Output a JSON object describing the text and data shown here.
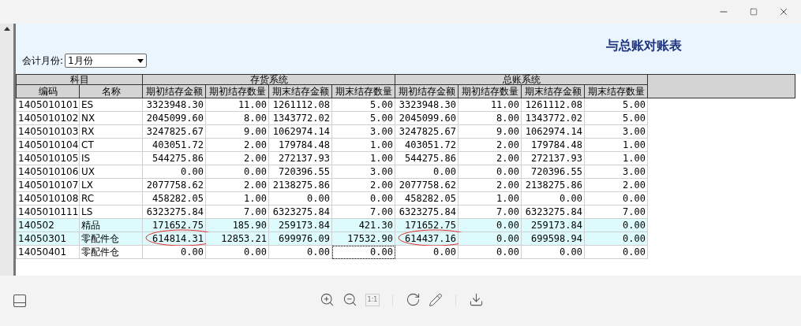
{
  "report": {
    "title": "与总账对账表",
    "month_label": "会计月份:",
    "month_value": "1月份",
    "group_headers": [
      "科目",
      "存货系统",
      "总账系统"
    ],
    "columns": [
      "编码",
      "名称",
      "期初结存金额",
      "期初结存数量",
      "期末结存金额",
      "期末结存数量",
      "期初结存金额",
      "期初结存数量",
      "期末结存金额",
      "期末结存数量"
    ],
    "rows": [
      {
        "highlighted": false,
        "cells": [
          {
            "text": "1405010101",
            "circled": false,
            "focused": false
          },
          {
            "text": "ES",
            "circled": false,
            "focused": false
          },
          {
            "text": "3323948.30",
            "circled": false,
            "focused": false
          },
          {
            "text": "11.00",
            "circled": false,
            "focused": false
          },
          {
            "text": "1261112.08",
            "circled": false,
            "focused": false
          },
          {
            "text": "5.00",
            "circled": false,
            "focused": false
          },
          {
            "text": "3323948.30",
            "circled": false,
            "focused": false
          },
          {
            "text": "11.00",
            "circled": false,
            "focused": false
          },
          {
            "text": "1261112.08",
            "circled": false,
            "focused": false
          },
          {
            "text": "5.00",
            "circled": false,
            "focused": false
          }
        ]
      },
      {
        "highlighted": false,
        "cells": [
          {
            "text": "1405010102",
            "circled": false,
            "focused": false
          },
          {
            "text": "NX",
            "circled": false,
            "focused": false
          },
          {
            "text": "2045099.60",
            "circled": false,
            "focused": false
          },
          {
            "text": "8.00",
            "circled": false,
            "focused": false
          },
          {
            "text": "1343772.02",
            "circled": false,
            "focused": false
          },
          {
            "text": "5.00",
            "circled": false,
            "focused": false
          },
          {
            "text": "2045099.60",
            "circled": false,
            "focused": false
          },
          {
            "text": "8.00",
            "circled": false,
            "focused": false
          },
          {
            "text": "1343772.02",
            "circled": false,
            "focused": false
          },
          {
            "text": "5.00",
            "circled": false,
            "focused": false
          }
        ]
      },
      {
        "highlighted": false,
        "cells": [
          {
            "text": "1405010103",
            "circled": false,
            "focused": false
          },
          {
            "text": "RX",
            "circled": false,
            "focused": false
          },
          {
            "text": "3247825.67",
            "circled": false,
            "focused": false
          },
          {
            "text": "9.00",
            "circled": false,
            "focused": false
          },
          {
            "text": "1062974.14",
            "circled": false,
            "focused": false
          },
          {
            "text": "3.00",
            "circled": false,
            "focused": false
          },
          {
            "text": "3247825.67",
            "circled": false,
            "focused": false
          },
          {
            "text": "9.00",
            "circled": false,
            "focused": false
          },
          {
            "text": "1062974.14",
            "circled": false,
            "focused": false
          },
          {
            "text": "3.00",
            "circled": false,
            "focused": false
          }
        ]
      },
      {
        "highlighted": false,
        "cells": [
          {
            "text": "1405010104",
            "circled": false,
            "focused": false
          },
          {
            "text": "CT",
            "circled": false,
            "focused": false
          },
          {
            "text": "403051.72",
            "circled": false,
            "focused": false
          },
          {
            "text": "2.00",
            "circled": false,
            "focused": false
          },
          {
            "text": "179784.48",
            "circled": false,
            "focused": false
          },
          {
            "text": "1.00",
            "circled": false,
            "focused": false
          },
          {
            "text": "403051.72",
            "circled": false,
            "focused": false
          },
          {
            "text": "2.00",
            "circled": false,
            "focused": false
          },
          {
            "text": "179784.48",
            "circled": false,
            "focused": false
          },
          {
            "text": "1.00",
            "circled": false,
            "focused": false
          }
        ]
      },
      {
        "highlighted": false,
        "cells": [
          {
            "text": "1405010105",
            "circled": false,
            "focused": false
          },
          {
            "text": "IS",
            "circled": false,
            "focused": false
          },
          {
            "text": "544275.86",
            "circled": false,
            "focused": false
          },
          {
            "text": "2.00",
            "circled": false,
            "focused": false
          },
          {
            "text": "272137.93",
            "circled": false,
            "focused": false
          },
          {
            "text": "1.00",
            "circled": false,
            "focused": false
          },
          {
            "text": "544275.86",
            "circled": false,
            "focused": false
          },
          {
            "text": "2.00",
            "circled": false,
            "focused": false
          },
          {
            "text": "272137.93",
            "circled": false,
            "focused": false
          },
          {
            "text": "1.00",
            "circled": false,
            "focused": false
          }
        ]
      },
      {
        "highlighted": false,
        "cells": [
          {
            "text": "1405010106",
            "circled": false,
            "focused": false
          },
          {
            "text": "UX",
            "circled": false,
            "focused": false
          },
          {
            "text": "0.00",
            "circled": false,
            "focused": false
          },
          {
            "text": "0.00",
            "circled": false,
            "focused": false
          },
          {
            "text": "720396.55",
            "circled": false,
            "focused": false
          },
          {
            "text": "3.00",
            "circled": false,
            "focused": false
          },
          {
            "text": "0.00",
            "circled": false,
            "focused": false
          },
          {
            "text": "0.00",
            "circled": false,
            "focused": false
          },
          {
            "text": "720396.55",
            "circled": false,
            "focused": false
          },
          {
            "text": "3.00",
            "circled": false,
            "focused": false
          }
        ]
      },
      {
        "highlighted": false,
        "cells": [
          {
            "text": "1405010107",
            "circled": false,
            "focused": false
          },
          {
            "text": "LX",
            "circled": false,
            "focused": false
          },
          {
            "text": "2077758.62",
            "circled": false,
            "focused": false
          },
          {
            "text": "2.00",
            "circled": false,
            "focused": false
          },
          {
            "text": "2138275.86",
            "circled": false,
            "focused": false
          },
          {
            "text": "2.00",
            "circled": false,
            "focused": false
          },
          {
            "text": "2077758.62",
            "circled": false,
            "focused": false
          },
          {
            "text": "2.00",
            "circled": false,
            "focused": false
          },
          {
            "text": "2138275.86",
            "circled": false,
            "focused": false
          },
          {
            "text": "2.00",
            "circled": false,
            "focused": false
          }
        ]
      },
      {
        "highlighted": false,
        "cells": [
          {
            "text": "1405010108",
            "circled": false,
            "focused": false
          },
          {
            "text": "RC",
            "circled": false,
            "focused": false
          },
          {
            "text": "458282.05",
            "circled": false,
            "focused": false
          },
          {
            "text": "1.00",
            "circled": false,
            "focused": false
          },
          {
            "text": "0.00",
            "circled": false,
            "focused": false
          },
          {
            "text": "0.00",
            "circled": false,
            "focused": false
          },
          {
            "text": "458282.05",
            "circled": false,
            "focused": false
          },
          {
            "text": "1.00",
            "circled": false,
            "focused": false
          },
          {
            "text": "0.00",
            "circled": false,
            "focused": false
          },
          {
            "text": "0.00",
            "circled": false,
            "focused": false
          }
        ]
      },
      {
        "highlighted": false,
        "cells": [
          {
            "text": "1405010111",
            "circled": false,
            "focused": false
          },
          {
            "text": "LS",
            "circled": false,
            "focused": false
          },
          {
            "text": "6323275.84",
            "circled": false,
            "focused": false
          },
          {
            "text": "7.00",
            "circled": false,
            "focused": false
          },
          {
            "text": "6323275.84",
            "circled": false,
            "focused": false
          },
          {
            "text": "7.00",
            "circled": false,
            "focused": false
          },
          {
            "text": "6323275.84",
            "circled": false,
            "focused": false
          },
          {
            "text": "7.00",
            "circled": false,
            "focused": false
          },
          {
            "text": "6323275.84",
            "circled": false,
            "focused": false
          },
          {
            "text": "7.00",
            "circled": false,
            "focused": false
          }
        ]
      },
      {
        "highlighted": true,
        "cells": [
          {
            "text": "140502",
            "circled": false,
            "focused": false
          },
          {
            "text": "精品",
            "circled": false,
            "focused": false
          },
          {
            "text": "171652.75",
            "circled": false,
            "focused": false
          },
          {
            "text": "185.90",
            "circled": false,
            "focused": false
          },
          {
            "text": "259173.84",
            "circled": false,
            "focused": false
          },
          {
            "text": "421.30",
            "circled": false,
            "focused": false
          },
          {
            "text": "171652.75",
            "circled": false,
            "focused": false
          },
          {
            "text": "0.00",
            "circled": false,
            "focused": false
          },
          {
            "text": "259173.84",
            "circled": false,
            "focused": false
          },
          {
            "text": "0.00",
            "circled": false,
            "focused": false
          }
        ]
      },
      {
        "highlighted": true,
        "cells": [
          {
            "text": "14050301",
            "circled": false,
            "focused": false
          },
          {
            "text": "零配件仓",
            "circled": false,
            "focused": false
          },
          {
            "text": "614814.31",
            "circled": true,
            "focused": false
          },
          {
            "text": "12853.21",
            "circled": false,
            "focused": false
          },
          {
            "text": "699976.09",
            "circled": false,
            "focused": false
          },
          {
            "text": "17532.90",
            "circled": false,
            "focused": false
          },
          {
            "text": "614437.16",
            "circled": true,
            "focused": false
          },
          {
            "text": "0.00",
            "circled": false,
            "focused": false
          },
          {
            "text": "699598.94",
            "circled": false,
            "focused": false
          },
          {
            "text": "0.00",
            "circled": false,
            "focused": false
          }
        ]
      },
      {
        "highlighted": false,
        "cells": [
          {
            "text": "14050401",
            "circled": false,
            "focused": false
          },
          {
            "text": "零配件仓",
            "circled": false,
            "focused": false
          },
          {
            "text": "0.00",
            "circled": false,
            "focused": false
          },
          {
            "text": "0.00",
            "circled": false,
            "focused": false
          },
          {
            "text": "0.00",
            "circled": false,
            "focused": false
          },
          {
            "text": "0.00",
            "circled": false,
            "focused": true
          },
          {
            "text": "0.00",
            "circled": false,
            "focused": false
          },
          {
            "text": "0.00",
            "circled": false,
            "focused": false
          },
          {
            "text": "0.00",
            "circled": false,
            "focused": false
          },
          {
            "text": "0.00",
            "circled": false,
            "focused": false
          }
        ]
      }
    ]
  },
  "toolbar": {
    "actual_size_label": "1:1"
  }
}
